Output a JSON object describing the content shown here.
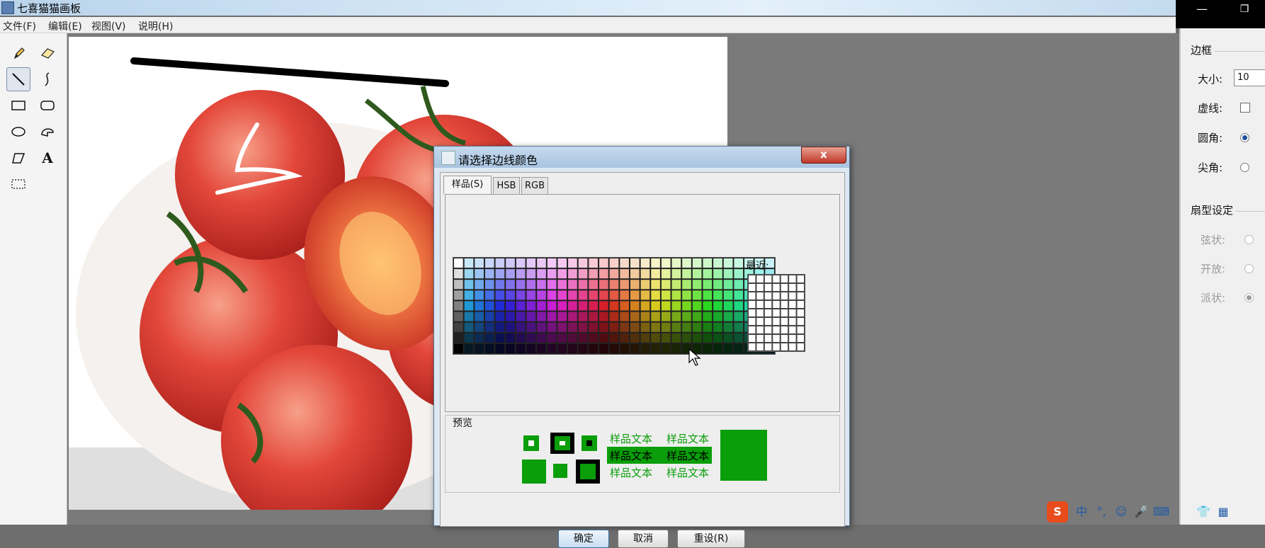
{
  "window": {
    "title": "七喜猫猫画板",
    "minimize_glyph": "—",
    "restore_glyph": "❐"
  },
  "menu": [
    "文件(F)",
    "编辑(E)",
    "视图(V)",
    "说明(H)"
  ],
  "toolbar": {
    "tools": [
      {
        "name": "pencil-icon"
      },
      {
        "name": "eraser-icon"
      },
      {
        "name": "line-icon",
        "selected": true
      },
      {
        "name": "curve-icon"
      },
      {
        "name": "rectangle-icon"
      },
      {
        "name": "rounded-rectangle-icon"
      },
      {
        "name": "oval-icon"
      },
      {
        "name": "arc-icon"
      },
      {
        "name": "polygon-icon"
      },
      {
        "name": "text-icon",
        "glyph": "A"
      },
      {
        "name": "select-icon"
      }
    ]
  },
  "panel": {
    "border_group": "边框",
    "size_label": "大小:",
    "size_value": "10",
    "dashed_label": "虚线:",
    "round_label": "圆角:",
    "sharp_label": "尖角:",
    "fan_group": "扇型设定",
    "chord_label": "弦状:",
    "open_label": "开放:",
    "pie_label": "派状:",
    "round_selected": true,
    "pie_selected": true
  },
  "dialog": {
    "title": "请选择边线颜色",
    "close_glyph": "x",
    "tabs": [
      "样品(S)",
      "HSB",
      "RGB"
    ],
    "recent_label": "最近:",
    "preview_label": "预览",
    "sample_text": "样品文本",
    "buttons": {
      "ok": "确定",
      "cancel": "取消",
      "reset": "重设(R)"
    },
    "preview_color": "#0a9e0a"
  },
  "ime_bar": {
    "items": [
      "S",
      "中",
      "°,",
      "☺",
      "🎤",
      "⌨",
      "👕",
      "▦"
    ]
  }
}
